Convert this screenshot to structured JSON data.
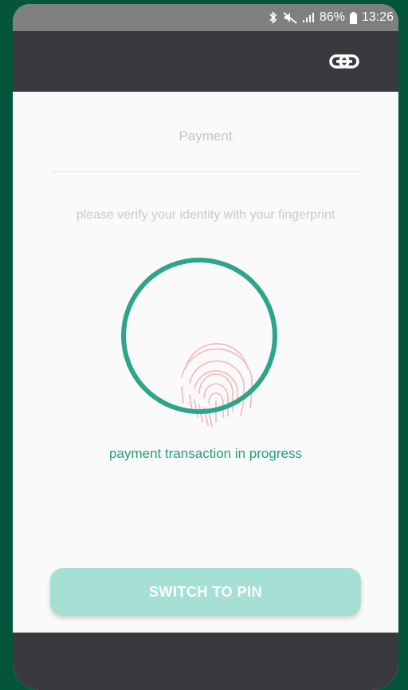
{
  "status_bar": {
    "battery_percent": "86%",
    "time": "13:26",
    "icons": [
      "bluetooth-icon",
      "mute-icon",
      "signal-icon",
      "battery-icon"
    ]
  },
  "header": {
    "logo_icon": "brand-link-logo-icon"
  },
  "main": {
    "title": "Payment",
    "instruction": "please verify your identity with your fingerprint",
    "scanner_icon": "fingerprint-icon",
    "progress_text": "payment transaction in progress",
    "switch_button_label": "SWITCH TO PIN"
  },
  "colors": {
    "frame": "#03553c",
    "accent": "#2ea58a",
    "progress_text": "#1f9e80",
    "button": "#a6e0d5",
    "fingerprint": "#f4b8bb",
    "app_bar": "#3a3a3e",
    "status_bar": "#7f7f7f"
  }
}
